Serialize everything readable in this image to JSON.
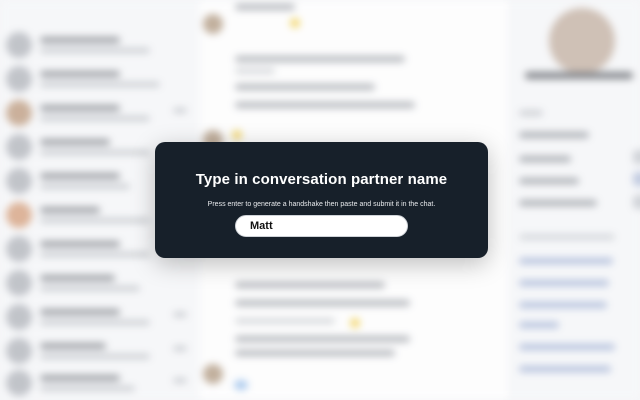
{
  "modal": {
    "title": "Type in conversation partner name",
    "instruction": "Press enter to generate a handshake then paste and submit it in the chat.",
    "name_input_value": "Matt"
  },
  "colors": {
    "modal_background": "#17202a",
    "modal_text": "#ffffff",
    "input_background": "#ffffff",
    "page_background": "#f4f5f7"
  }
}
